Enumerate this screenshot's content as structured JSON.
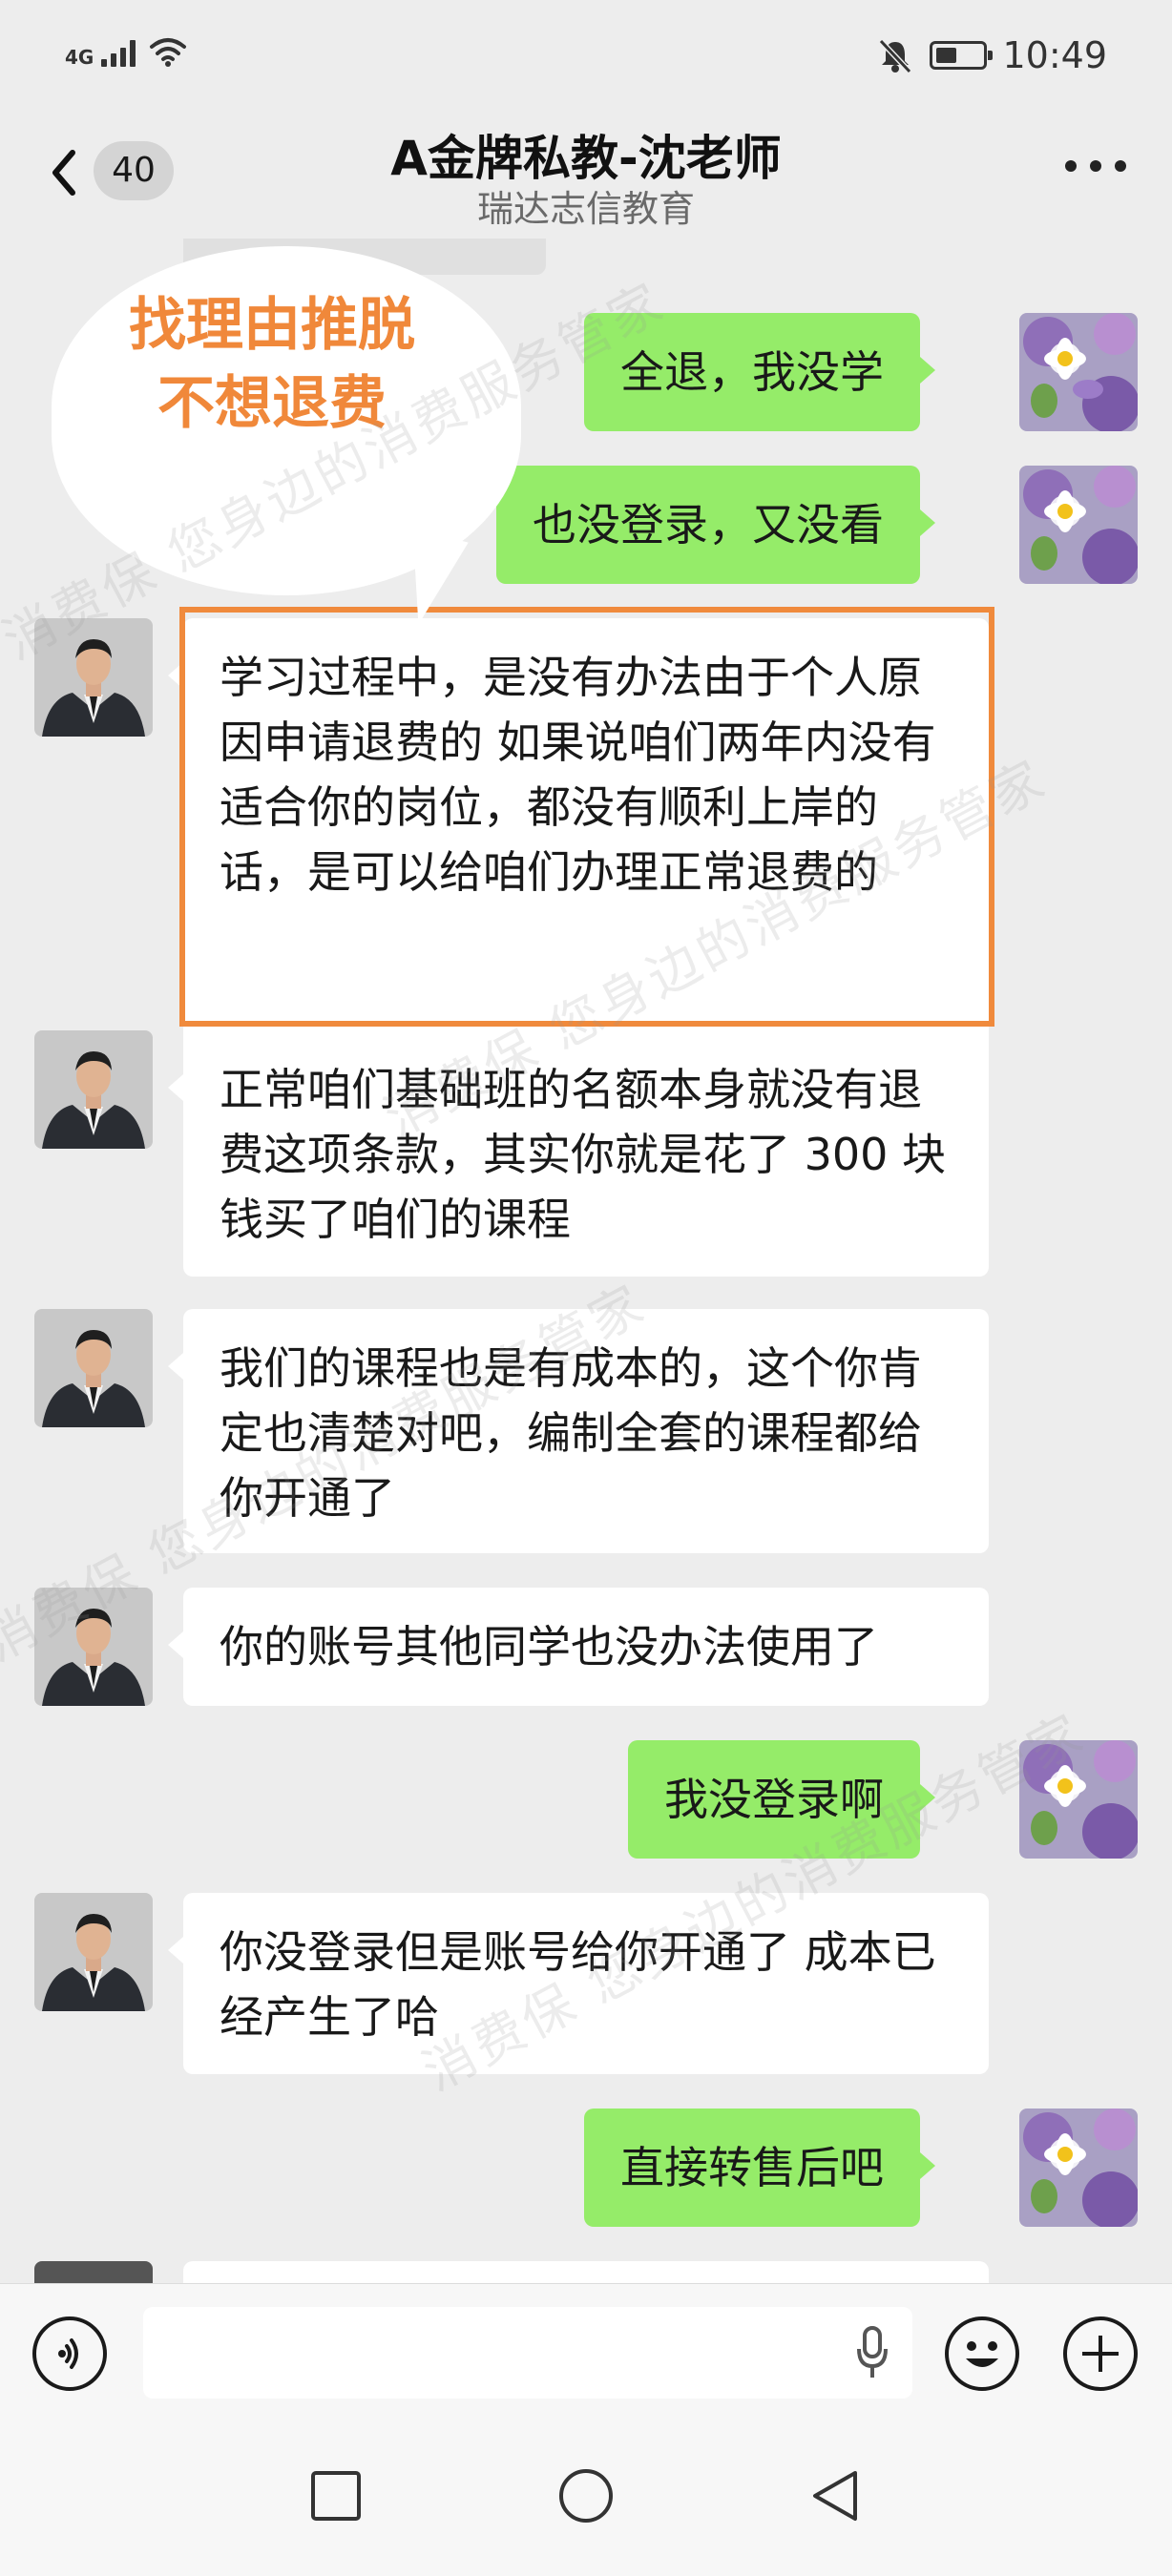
{
  "status_bar": {
    "network": "4G",
    "time": "10:49",
    "battery_level": 0.45
  },
  "header": {
    "back_badge": "40",
    "title": "A金牌私教-沈老师",
    "subtitle": "瑞达志信教育"
  },
  "callout": {
    "text": "找理由推脱不想退费"
  },
  "watermark": {
    "text": "消费保 您身边的消费服务管家"
  },
  "messages": [
    {
      "sender": "me",
      "text": "全退，我没学"
    },
    {
      "sender": "me",
      "text": "也没登录，又没看"
    },
    {
      "sender": "other",
      "text": "学习过程中，是没有办法由于个人原因申请退费的 如果说咱们两年内没有适合你的岗位，都没有顺利上岸的话，是可以给咱们办理正常退费的",
      "highlighted": true
    },
    {
      "sender": "other",
      "text": "正常咱们基础班的名额本身就没有退费这项条款，其实你就是花了 300 块钱买了咱们的课程"
    },
    {
      "sender": "other",
      "text": "我们的课程也是有成本的，这个你肯定也清楚对吧，编制全套的课程都给你开通了"
    },
    {
      "sender": "other",
      "text": "你的账号其他同学也没办法使用了"
    },
    {
      "sender": "me",
      "text": "我没登录啊"
    },
    {
      "sender": "other",
      "text": "你没登录但是账号给你开通了 成本已经产生了哈"
    },
    {
      "sender": "me",
      "text": "直接转售后吧"
    }
  ],
  "input_bar": {
    "icons": [
      "voice-icon",
      "microphone-icon",
      "emoji-icon",
      "plus-icon"
    ]
  },
  "nav_keys": {
    "icons": [
      "square-icon",
      "home-circle-icon",
      "back-triangle-icon"
    ]
  },
  "colors": {
    "my_bubble": "#95ec69",
    "other_bubble": "#ffffff",
    "highlight": "#f08a3c",
    "callout_text": "#f0883a",
    "background": "#ededed"
  }
}
